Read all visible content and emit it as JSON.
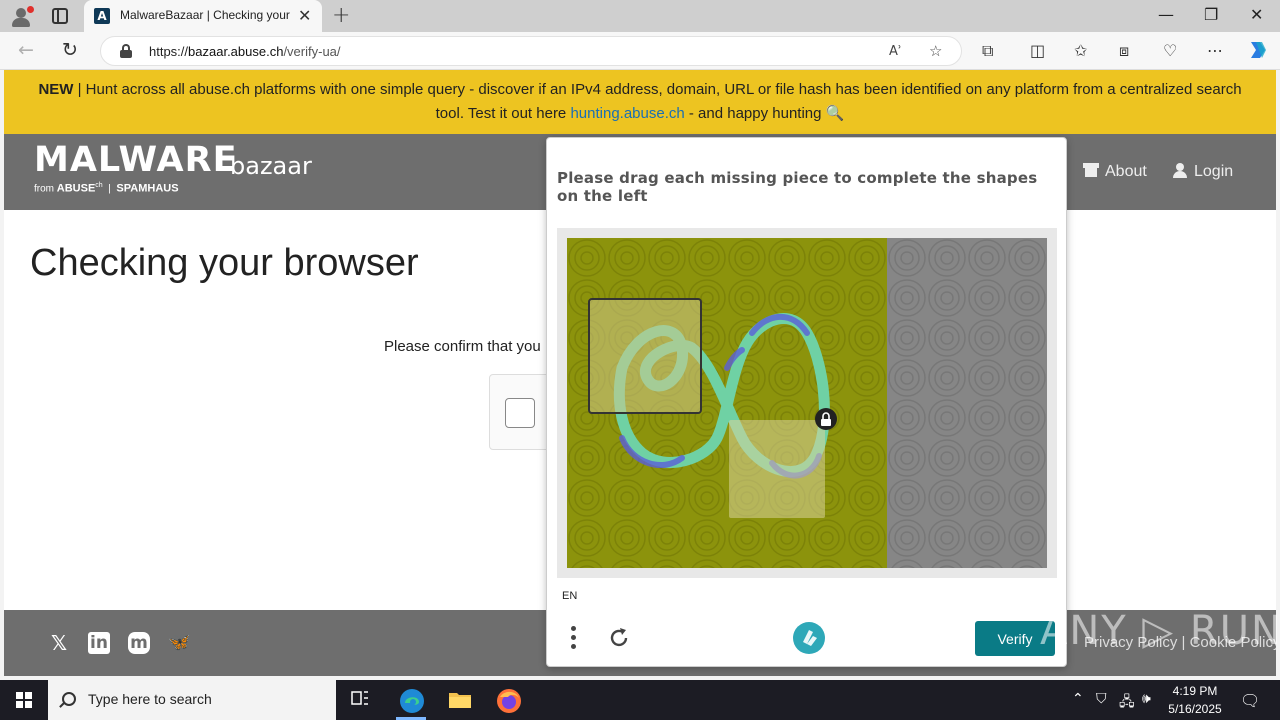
{
  "browser": {
    "tab_title": "MalwareBazaar | Checking your browser",
    "favicon": "A",
    "url_scheme": "https://",
    "url_host": "bazaar.abuse.ch",
    "url_path": "/verify-ua/"
  },
  "banner": {
    "new_label": "NEW",
    "text_before": " | Hunt across all abuse.ch platforms with one simple query - discover if an IPv4 address, domain, URL or file hash has been identified on any platform from a centralized search tool. Test it out here ",
    "link_text": "hunting.abuse.ch",
    "text_after": " - and happy hunting 🔍"
  },
  "header": {
    "logo_main": "MALWARE",
    "logo_sub": "bazaar",
    "logo_from": "from",
    "logo_abuse": "ABUSE",
    "logo_abuse_sup": "ch",
    "logo_spamhaus": "SPAMHAUS",
    "nav": [
      {
        "label": "About",
        "icon": "home-icon"
      },
      {
        "label": "Login",
        "icon": "user-icon"
      }
    ]
  },
  "main": {
    "title": "Checking your browser",
    "confirm_text": "Please confirm that you"
  },
  "footer": {
    "social": [
      {
        "name": "x-icon",
        "glyph": "𝕏"
      },
      {
        "name": "linkedin-icon",
        "glyph": "in"
      },
      {
        "name": "mastodon-icon",
        "glyph": "m"
      },
      {
        "name": "bluesky-icon",
        "glyph": "🦋"
      }
    ],
    "links_text": "Privacy Policy | Cookie Policy"
  },
  "captcha": {
    "prompt": "Please drag each missing piece to complete the shapes on the left",
    "language": "EN",
    "verify_label": "Verify"
  },
  "watermark": "ANY ▷ RUN",
  "taskbar": {
    "search_placeholder": "Type here to search",
    "time": "4:19 PM",
    "date": "5/16/2025"
  },
  "colors": {
    "banner": "#edc421",
    "header": "#6e6e6e",
    "verify": "#0a7b86",
    "puzzle_left": "#8c930c",
    "puzzle_right": "#868686"
  }
}
